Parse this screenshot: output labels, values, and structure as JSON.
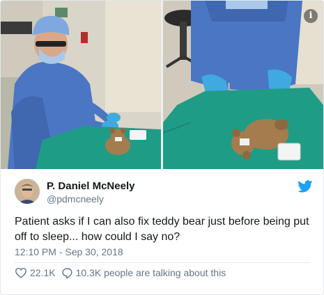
{
  "media": {
    "info_icon": "info-icon",
    "info_glyph": "i"
  },
  "author": {
    "display_name": "P. Daniel McNeely",
    "handle": "@pdmcneely",
    "avatar_icon": "avatar"
  },
  "brand": {
    "icon": "twitter-bird-icon",
    "color": "#1da1f2"
  },
  "tweet": {
    "text": "Patient asks if I can also fix teddy bear just before being put off to sleep... how could I say no?",
    "timestamp": "12:10 PM - Sep 30, 2018"
  },
  "stats": {
    "likes": "22.1K",
    "conversation": "10.3K people are talking about this",
    "like_icon": "heart-icon",
    "reply_icon": "speech-bubble-icon"
  }
}
